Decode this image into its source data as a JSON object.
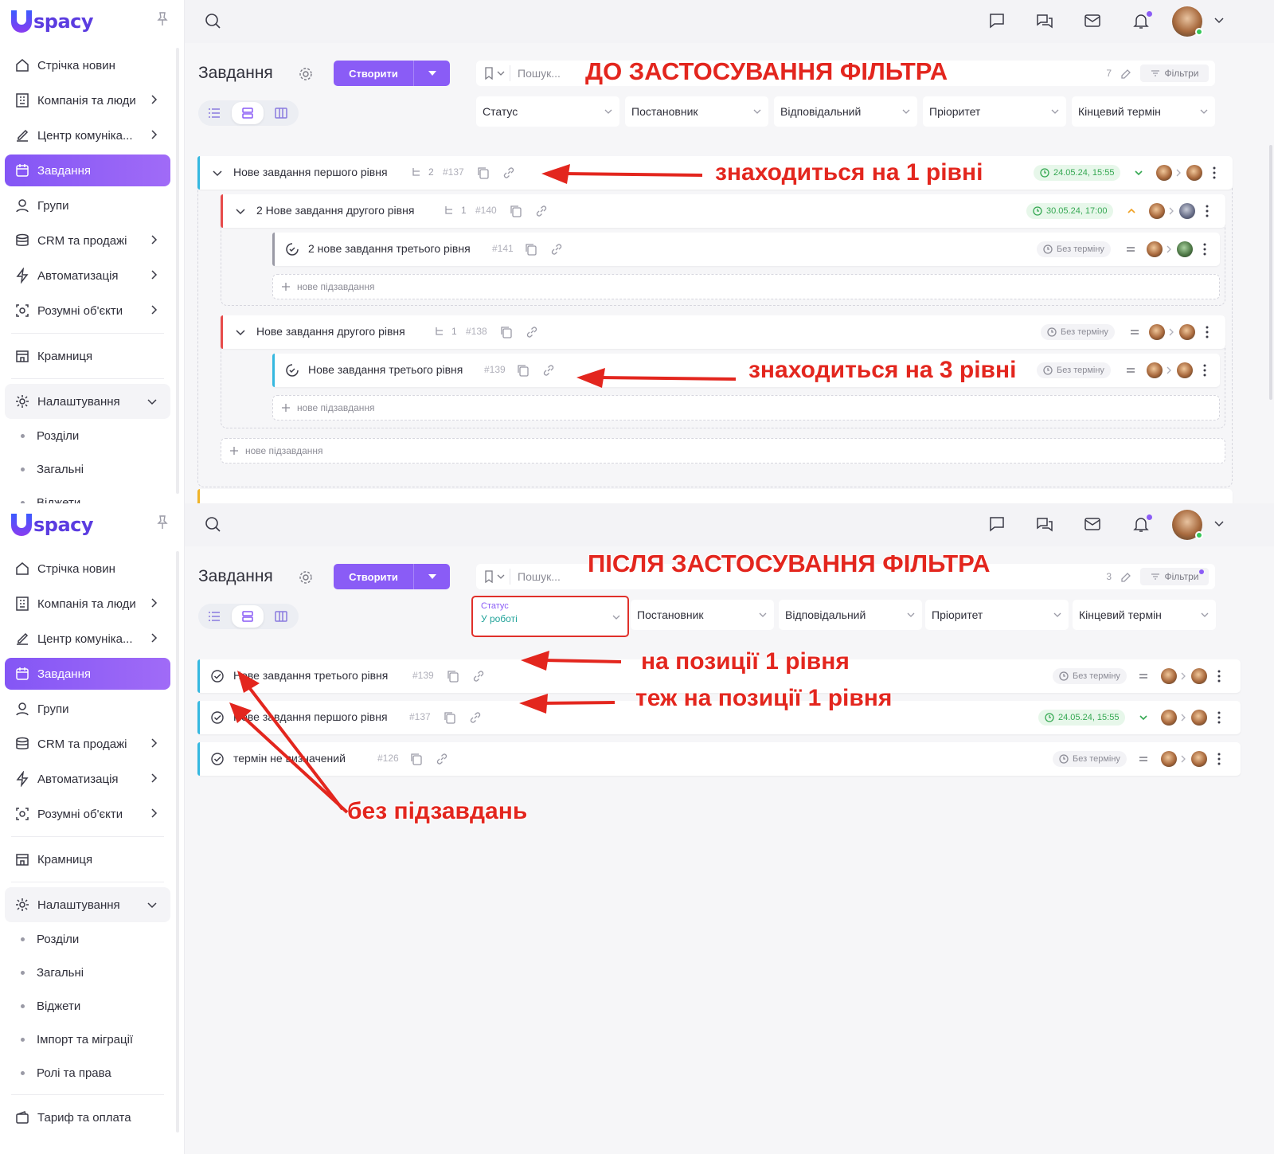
{
  "app": {
    "logo_text": "spacy",
    "brand_color": "#8a5cf6"
  },
  "sidebar_top": {
    "items": [
      {
        "label": "Стрічка новин",
        "icon": "home-icon"
      },
      {
        "label": "Компанія та люди",
        "icon": "building-icon"
      },
      {
        "label": "Центр комуніка...",
        "icon": "edit-icon"
      },
      {
        "label": "Завдання",
        "icon": "calendar-icon",
        "active": true
      },
      {
        "label": "Групи",
        "icon": "user-icon"
      },
      {
        "label": "CRM та продажі",
        "icon": "crm-icon"
      },
      {
        "label": "Автоматизація",
        "icon": "bolt-icon"
      },
      {
        "label": "Розумні об'єкти",
        "icon": "smart-object-icon"
      },
      {
        "label": "Крамниця",
        "icon": "store-icon"
      },
      {
        "label": "Налаштування",
        "icon": "settings-icon"
      }
    ],
    "sub_items": [
      "Розділи",
      "Загальні",
      "Віджети"
    ]
  },
  "sidebar_bottom": {
    "items": [
      {
        "label": "Стрічка новин"
      },
      {
        "label": "Компанія та люди"
      },
      {
        "label": "Центр комуніка..."
      },
      {
        "label": "Завдання"
      },
      {
        "label": "Групи"
      },
      {
        "label": "CRM та продажі"
      },
      {
        "label": "Автоматизація"
      },
      {
        "label": "Розумні об'єкти"
      },
      {
        "label": "Крамниця"
      },
      {
        "label": "Налаштування"
      }
    ],
    "sub_items": [
      "Розділи",
      "Загальні",
      "Віджети",
      "Імпорт та міграції",
      "Ролі та права"
    ],
    "billing": "Тариф та оплата"
  },
  "header": {
    "title": "Завдання",
    "create_label": "Створити",
    "search_placeholder": "Пошук...",
    "filters_label": "Фільтри",
    "count_before": "7",
    "count_after": "3"
  },
  "filters": {
    "status": "Статус",
    "status_value": "У роботі",
    "author": "Постановник",
    "responsible": "Відповідальний",
    "priority": "Пріоритет",
    "deadline": "Кінцевий термін"
  },
  "annotations": {
    "before": "ДО ЗАСТОСУВАННЯ ФІЛЬТРА",
    "after": "ПІСЛЯ ЗАСТОСУВАННЯ ФІЛЬТРА",
    "level1": "знаходиться на 1 рівні",
    "level3": "знаходиться на 3 рівні",
    "pos1": "на позиції 1 рівня",
    "pos1_also": "теж на позиції 1 рівня",
    "no_subtasks": "без підзавдань"
  },
  "tasks_before": [
    {
      "title": "Нове завдання першого рівня",
      "subcount": "2",
      "id": "#137",
      "deadline": "24.05.24, 15:55"
    },
    {
      "title": "2 Нове завдання другого рівня",
      "subcount": "1",
      "id": "#140",
      "deadline": "30.05.24, 17:00"
    },
    {
      "title": "2 нове завдання третього рівня",
      "id": "#141",
      "deadline": "Без терміну"
    },
    {
      "title": "Нове завдання другого рівня",
      "subcount": "1",
      "id": "#138",
      "deadline": "Без терміну"
    },
    {
      "title": "Нове завдання третього рівня",
      "id": "#139",
      "deadline": "Без терміну"
    }
  ],
  "add_subtask": "нове підзавдання",
  "tasks_after": [
    {
      "title": "Нове завдання третього рівня",
      "id": "#139",
      "deadline": "Без терміну"
    },
    {
      "title": "Нове завдання першого рівня",
      "id": "#137",
      "deadline": "24.05.24, 15:55"
    },
    {
      "title": "термін не визначений",
      "id": "#126",
      "deadline": "Без терміну"
    }
  ]
}
